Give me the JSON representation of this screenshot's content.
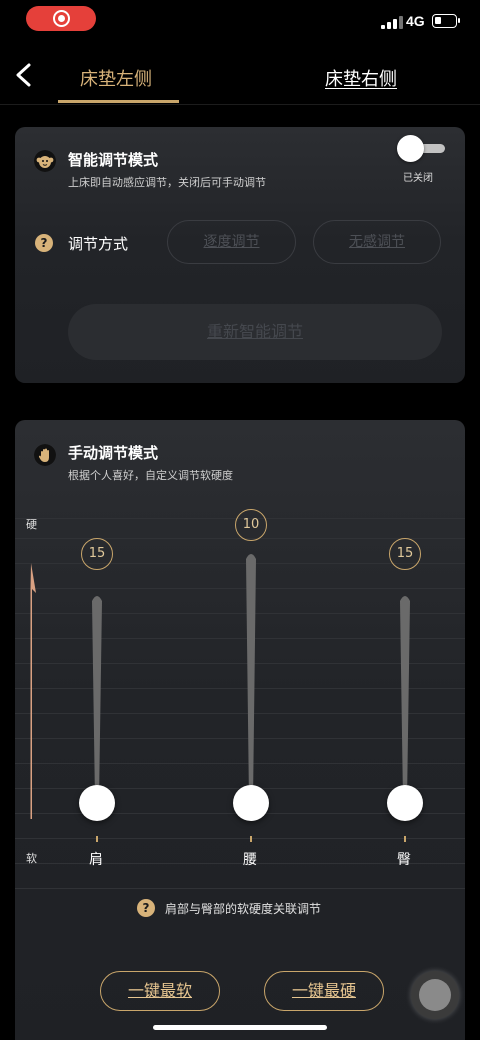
{
  "status_bar": {
    "network": "4G"
  },
  "nav": {
    "tab_left": "床垫左侧",
    "tab_right": "床垫右侧"
  },
  "smart_mode": {
    "title": "智能调节模式",
    "subtitle": "上床即自动感应调节，关闭后可手动调节",
    "toggle_label": "已关闭",
    "toggle_on": false,
    "adjust_label": "调节方式",
    "option_1": "逐度调节",
    "option_2": "无感调节",
    "refresh_button": "重新智能调节"
  },
  "manual_mode": {
    "title": "手动调节模式",
    "subtitle": "根据个人喜好，自定义调节软硬度",
    "axis_hard": "硬",
    "axis_soft": "软",
    "sliders": [
      {
        "label": "肩",
        "value": "15"
      },
      {
        "label": "腰",
        "value": "10"
      },
      {
        "label": "臀",
        "value": "15"
      }
    ],
    "hint": "肩部与臀部的软硬度关联调节",
    "softest_button": "一键最软",
    "hardest_button": "一键最硬"
  },
  "colors": {
    "accent": "#c9a66b",
    "record": "#e5403a",
    "card": "#222428"
  }
}
